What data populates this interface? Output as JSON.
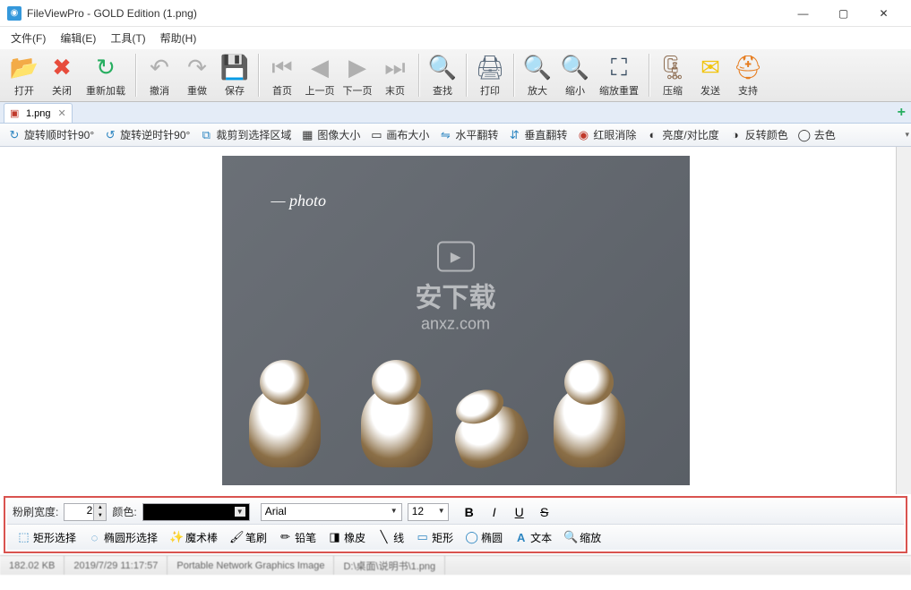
{
  "window": {
    "title": "FileViewPro - GOLD Edition (1.png)"
  },
  "menubar": [
    "文件(F)",
    "编辑(E)",
    "工具(T)",
    "帮助(H)"
  ],
  "toolbar": {
    "open": "打开",
    "close": "关闭",
    "reload": "重新加载",
    "undo": "撤消",
    "redo": "重做",
    "save": "保存",
    "first": "首页",
    "prev": "上一页",
    "next": "下一页",
    "last": "末页",
    "find": "查找",
    "print": "打印",
    "zoomin": "放大",
    "zoomout": "缩小",
    "zoomreset": "缩放重置",
    "zip": "压缩",
    "send": "发送",
    "support": "支持"
  },
  "tab": {
    "name": "1.png"
  },
  "edit_toolbar": {
    "rotate_cw": "旋转顺时针90°",
    "rotate_ccw": "旋转逆时针90°",
    "crop": "裁剪到选择区域",
    "image_size": "图像大小",
    "canvas_size": "画布大小",
    "flip_h": "水平翻转",
    "flip_v": "垂直翻转",
    "redeye": "红眼消除",
    "brightness": "亮度/对比度",
    "invert": "反转颜色",
    "desaturate": "去色"
  },
  "image_watermark": {
    "signature": "— photo",
    "center_line1": "安下载",
    "center_line2": "anxz.com"
  },
  "paint": {
    "brush_width_label": "粉刷宽度:",
    "brush_width_value": "2",
    "color_label": "颜色:",
    "color_value": "#000000",
    "font_name": "Arial",
    "font_size": "12"
  },
  "tools": {
    "rect_select": "矩形选择",
    "ellipse_select": "椭圆形选择",
    "magic_wand": "魔术棒",
    "brush": "笔刷",
    "pencil": "铅笔",
    "eraser": "橡皮",
    "line": "线",
    "rectangle": "矩形",
    "ellipse": "椭圆",
    "text": "文本",
    "zoom": "缩放"
  },
  "status": {
    "size": "182.02 KB",
    "date": "2019/7/29 11:17:57",
    "type": "Portable Network Graphics Image",
    "path": "D:\\桌面\\说明书\\1.png"
  }
}
